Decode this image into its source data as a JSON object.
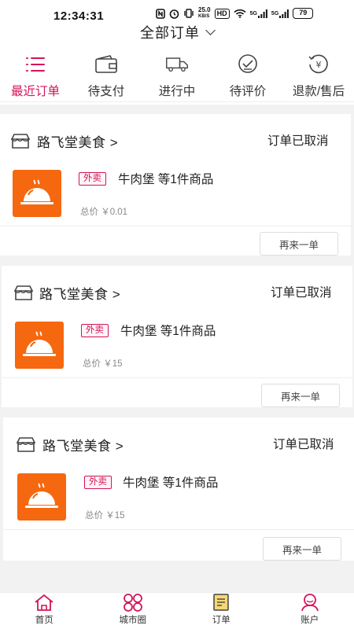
{
  "status_bar": {
    "time": "12:34:31",
    "speed_value": "25.0",
    "speed_unit": "KB/S",
    "hd": "HD",
    "signal1": "5G",
    "signal2": "5G",
    "battery": "79"
  },
  "header": {
    "title": "全部订单"
  },
  "tabs": [
    {
      "label": "最近订单",
      "icon": "list-icon",
      "active": true
    },
    {
      "label": "待支付",
      "icon": "wallet-icon",
      "active": false
    },
    {
      "label": "进行中",
      "icon": "truck-icon",
      "active": false
    },
    {
      "label": "待评价",
      "icon": "comment-check-icon",
      "active": false
    },
    {
      "label": "退款/售后",
      "icon": "refund-yen-icon",
      "active": false
    }
  ],
  "orders": [
    {
      "store": "路飞堂美食 >",
      "status": "订单已取消",
      "tag": "外卖",
      "item": "牛肉堡 等1件商品",
      "total": "总价 ￥0.01",
      "button": "再来一单"
    },
    {
      "store": "路飞堂美食 >",
      "status": "订单已取消",
      "tag": "外卖",
      "item": "牛肉堡 等1件商品",
      "total": "总价 ￥15",
      "button": "再来一单"
    },
    {
      "store": "路飞堂美食 >",
      "status": "订单已取消",
      "tag": "外卖",
      "item": "牛肉堡 等1件商品",
      "total": "总价 ￥15",
      "button": "再来一单"
    }
  ],
  "bottom_nav": [
    {
      "label": "首页",
      "icon": "home-icon"
    },
    {
      "label": "城市圈",
      "icon": "city-circle-icon"
    },
    {
      "label": "订单",
      "icon": "order-note-icon"
    },
    {
      "label": "账户",
      "icon": "account-icon"
    }
  ],
  "colors": {
    "accent": "#d4145a",
    "food_thumb": "#f5680f",
    "background_gray": "#f2f2f2",
    "nav_icon": "#d4145a"
  }
}
